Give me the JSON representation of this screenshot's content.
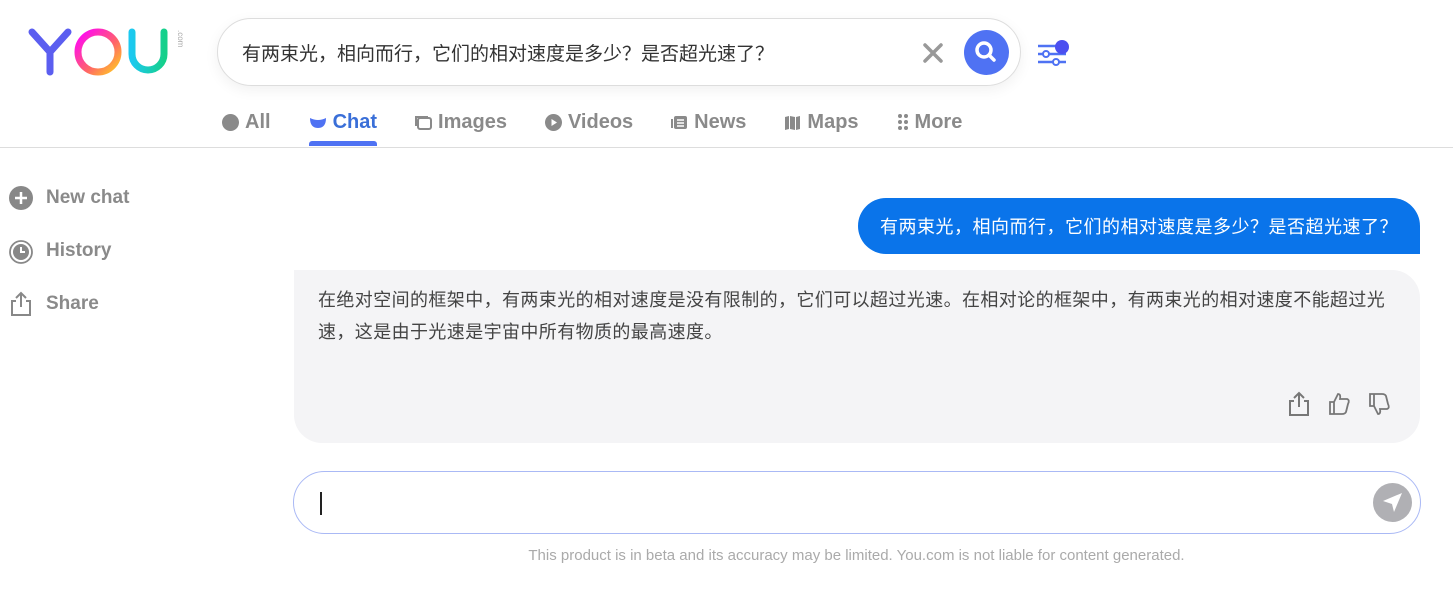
{
  "logo": {
    "text": "YOU",
    "suffix": ".com"
  },
  "search": {
    "value": "有两束光，相向而行，它们的相对速度是多少？是否超光速了？"
  },
  "tabs": [
    {
      "label": "All",
      "icon": "search-icon"
    },
    {
      "label": "Chat",
      "icon": "chat-icon",
      "active": true
    },
    {
      "label": "Images",
      "icon": "images-icon"
    },
    {
      "label": "Videos",
      "icon": "play-icon"
    },
    {
      "label": "News",
      "icon": "news-icon"
    },
    {
      "label": "Maps",
      "icon": "map-icon"
    },
    {
      "label": "More",
      "icon": "dots-grid-icon"
    }
  ],
  "sidebar": {
    "items": [
      {
        "label": "New chat",
        "icon": "plus-circle-icon"
      },
      {
        "label": "History",
        "icon": "history-icon"
      },
      {
        "label": "Share",
        "icon": "share-icon"
      }
    ]
  },
  "chat": {
    "user_message": "有两束光，相向而行，它们的相对速度是多少？是否超光速了？",
    "assistant_message": "在绝对空间的框架中，有两束光的相对速度是没有限制的，它们可以超过光速。在相对论的框架中，有两束光的相对速度不能超过光速，这是由于光速是宇宙中所有物质的最高速度。",
    "input_value": "",
    "disclaimer": "This product is in beta and its accuracy may be limited. You.com is not liable for content generated."
  },
  "colors": {
    "accent": "#4f72f3",
    "user_bubble": "#0a74ea",
    "active_tab": "#3a6fd8"
  }
}
